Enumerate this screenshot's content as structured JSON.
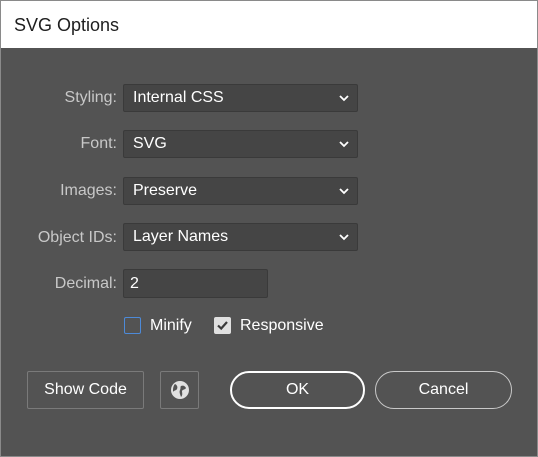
{
  "dialog": {
    "title": "SVG Options"
  },
  "fields": {
    "styling": {
      "label": "Styling:",
      "value": "Internal CSS"
    },
    "font": {
      "label": "Font:",
      "value": "SVG"
    },
    "images": {
      "label": "Images:",
      "value": "Preserve"
    },
    "object_ids": {
      "label": "Object IDs:",
      "value": "Layer Names"
    },
    "decimal": {
      "label": "Decimal:",
      "value": "2"
    }
  },
  "options": {
    "minify": {
      "label": "Minify",
      "checked": false
    },
    "responsive": {
      "label": "Responsive",
      "checked": true
    }
  },
  "buttons": {
    "show_code": "Show Code",
    "ok": "OK",
    "cancel": "Cancel"
  },
  "icons": {
    "dropdown": "chevron-down-icon",
    "globe": "globe-icon",
    "check": "checkmark-icon"
  },
  "colors": {
    "panel": "#535353",
    "field": "#454545",
    "focus_border": "#4d8ad8"
  }
}
